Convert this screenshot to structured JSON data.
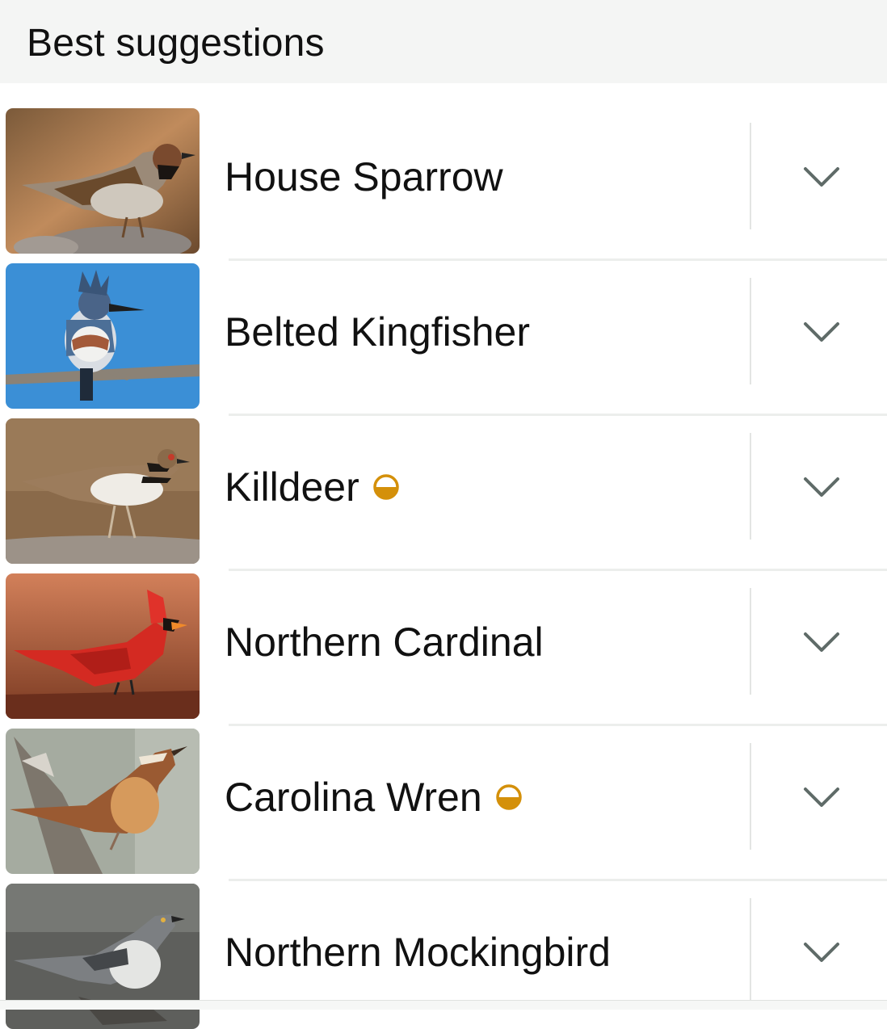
{
  "header": {
    "title": "Best suggestions"
  },
  "suggestions": [
    {
      "name": "House Sparrow",
      "image_icon": "house-sparrow-photo",
      "badge": null
    },
    {
      "name": "Belted Kingfisher",
      "image_icon": "belted-kingfisher-photo",
      "badge": null
    },
    {
      "name": "Killdeer",
      "image_icon": "killdeer-photo",
      "badge": "half-filled-circle-icon"
    },
    {
      "name": "Northern Cardinal",
      "image_icon": "northern-cardinal-photo",
      "badge": null
    },
    {
      "name": "Carolina Wren",
      "image_icon": "carolina-wren-photo",
      "badge": "half-filled-circle-icon"
    },
    {
      "name": "Northern Mockingbird",
      "image_icon": "northern-mockingbird-photo",
      "badge": null
    }
  ],
  "colors": {
    "badge": "#d4900a",
    "chevron": "#5f6b68",
    "header_bg": "#f4f5f4"
  }
}
